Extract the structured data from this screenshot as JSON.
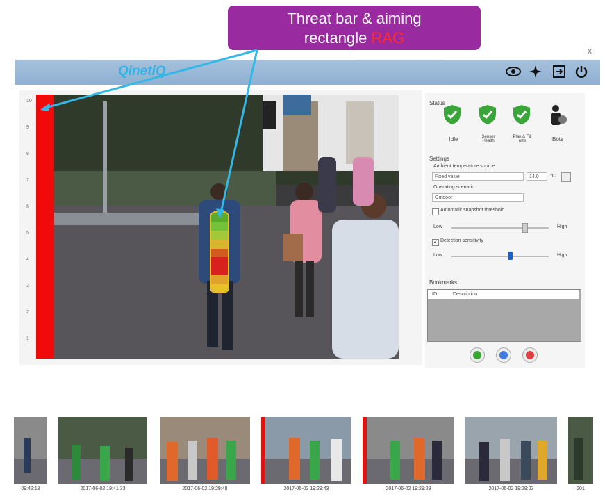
{
  "slide_title": "",
  "callout": {
    "line1": "Threat bar & aiming",
    "line2": "rectangle",
    "line2_red": "RAG"
  },
  "close_label": "x",
  "app": {
    "logo": "QinetiQ",
    "toolbar": [
      {
        "name": "eye-icon",
        "glyph": "👁"
      },
      {
        "name": "settings-tool-icon",
        "glyph": "✱"
      },
      {
        "name": "export-icon",
        "glyph": "⊡"
      },
      {
        "name": "power-icon",
        "glyph": "⏻"
      }
    ]
  },
  "threat_scale": [
    "10",
    "9",
    "8",
    "7",
    "6",
    "5",
    "4",
    "3",
    "2",
    "1"
  ],
  "status": {
    "title": "Status",
    "items": [
      {
        "label": "Idle",
        "color": "#3aa63a"
      },
      {
        "label": "Sensor Health",
        "color": "#3aa63a"
      },
      {
        "label": "Plan & Fill rate",
        "color": "#3aa63a"
      },
      {
        "label": "Bots",
        "color": "#222222"
      }
    ]
  },
  "settings": {
    "title": "Settings",
    "ambient_label": "Ambient temperature source",
    "ambient_value": "Fixed value",
    "ambient_number": "14.0",
    "ambient_unit": "°C",
    "scenario_label": "Operating scenario",
    "scenario_value": "Outdoor",
    "auto_threshold_label": "Automatic snapshot threshold",
    "low": "Low",
    "high": "High",
    "detection_label": "Detection sensitivity",
    "slider1_level": 0.75,
    "slider2_level": 0.6
  },
  "bookmarks": {
    "title": "Bookmarks",
    "col_id": "ID",
    "col_desc": "Description"
  },
  "thumbnails": [
    {
      "label": "09:42:18",
      "red": false
    },
    {
      "label": "2017-06-02 19:41:33",
      "red": false
    },
    {
      "label": "2017-06-02 19:29:48",
      "red": false
    },
    {
      "label": "2017-06-02 19:29:43",
      "red": true
    },
    {
      "label": "2017-06-02 19:29:29",
      "red": true
    },
    {
      "label": "2017-06-02 19:29:23",
      "red": false
    },
    {
      "label": "201",
      "red": false
    }
  ],
  "colors": {
    "threat_bar": "#f10a0a",
    "callout": "#9a2aa0",
    "arrow": "#33b8e6"
  }
}
